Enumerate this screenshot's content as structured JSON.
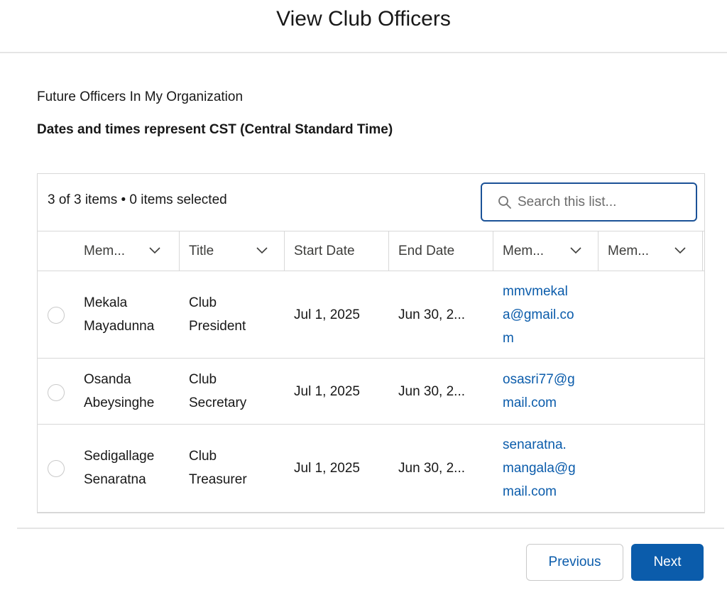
{
  "header": {
    "title": "View Club Officers"
  },
  "subtitle": "Future Officers In My Organization",
  "timezone_note": "Dates and times represent CST (Central Standard Time)",
  "list": {
    "count_text": "3 of 3 items • 0 items selected",
    "search": {
      "placeholder": "Search this list...",
      "value": ""
    },
    "columns": [
      {
        "label": "Mem...",
        "sortable_menu": true
      },
      {
        "label": "Title",
        "sortable_menu": true
      },
      {
        "label": "Start Date",
        "sortable_menu": false
      },
      {
        "label": "End Date",
        "sortable_menu": false
      },
      {
        "label": "Mem...",
        "sortable_menu": true
      },
      {
        "label": "Mem...",
        "sortable_menu": true
      }
    ],
    "rows": [
      {
        "member_line1": "Mekala",
        "member_line2": "Mayadunna",
        "title_line1": "Club",
        "title_line2": "President",
        "start_date": "Jul 1, 2025",
        "end_date": "Jun 30, 2...",
        "email_line1": "mmvmekal",
        "email_line2": "a@gmail.co",
        "email_line3": "m"
      },
      {
        "member_line1": "Osanda",
        "member_line2": "Abeysinghe",
        "title_line1": "Club",
        "title_line2": "Secretary",
        "start_date": "Jul 1, 2025",
        "end_date": "Jun 30, 2...",
        "email_line1": "osasri77@g",
        "email_line2": "mail.com"
      },
      {
        "member_line1": "Sedigallage",
        "member_line2": "Senaratna",
        "title_line1": "Club",
        "title_line2": "Treasurer",
        "start_date": "Jul 1, 2025",
        "end_date": "Jun 30, 2...",
        "email_line1": "senaratna.",
        "email_line2": "mangala@g",
        "email_line3": "mail.com"
      }
    ]
  },
  "footer": {
    "previous_label": "Previous",
    "next_label": "Next"
  },
  "colors": {
    "brand": "#0b5cab",
    "focus_border": "#1b5297",
    "border": "#d8d8d8"
  }
}
